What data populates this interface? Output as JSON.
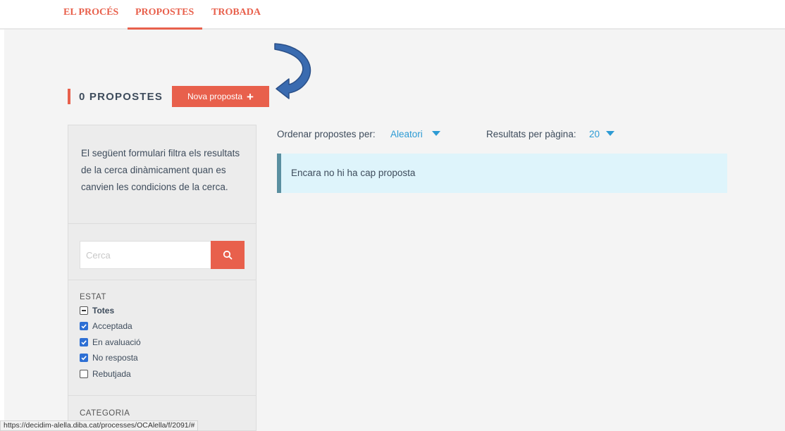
{
  "nav": {
    "items": [
      {
        "label": "EL PROCÉS"
      },
      {
        "label": "PROPOSTES"
      },
      {
        "label": "TROBADA"
      }
    ],
    "accent": "#e8604c"
  },
  "header": {
    "title": "0 PROPOSTES",
    "new_button": "Nova proposta"
  },
  "sidebar": {
    "description": "El següent formulari filtra els resultats de la cerca dinàmicament quan es canvien les condicions de la cerca.",
    "search_placeholder": "Cerca",
    "estat": {
      "title": "ESTAT",
      "options": [
        {
          "label": "Totes",
          "state": "partial"
        },
        {
          "label": "Acceptada",
          "state": "checked"
        },
        {
          "label": "En avaluació",
          "state": "checked"
        },
        {
          "label": "No resposta",
          "state": "checked"
        },
        {
          "label": "Rebutjada",
          "state": "unchecked"
        }
      ]
    },
    "categoria_title": "CATEGORIA"
  },
  "controls": {
    "sort_label": "Ordenar propostes per:",
    "sort_value": "Aleatori",
    "per_page_label": "Resultats per pàgina:",
    "per_page_value": "20"
  },
  "results": {
    "empty_message": "Encara no hi ha cap proposta"
  },
  "statusbar": {
    "url": "https://decidim-alella.diba.cat/processes/OCAlella/f/2091/#"
  },
  "colors": {
    "accent": "#e8604c",
    "link": "#2d9bd4",
    "checkbox": "#2d6fd4",
    "info_bg": "#def4fb",
    "arrow": "#3a6bb0"
  }
}
